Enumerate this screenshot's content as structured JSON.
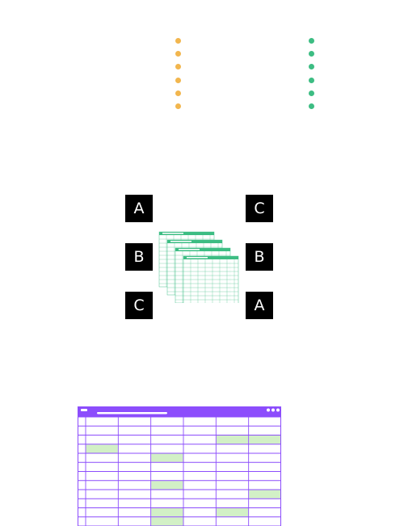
{
  "colors": {
    "yellow_dots": "#f2b64e",
    "green_dots": "#3dbd83",
    "tile_bg": "#000000",
    "tile_text": "#ffffff",
    "sheet_accent": "#3dbd83",
    "window_purple": "#8c4dfc",
    "highlight_green": "#d2f0c6"
  },
  "tiles_left": [
    "A",
    "B",
    "C"
  ],
  "tiles_right": [
    "C",
    "B",
    "A"
  ],
  "sheets": {
    "count": 4,
    "icon": "spreadsheet-stack-icon"
  },
  "grid_window": {
    "icon": "spreadsheet-window-icon",
    "window_buttons": 3,
    "rows": 12,
    "columns": 6,
    "highlighted_cells": [
      [
        2,
        4
      ],
      [
        2,
        5
      ],
      [
        3,
        0
      ],
      [
        4,
        2
      ],
      [
        7,
        2
      ],
      [
        8,
        5
      ],
      [
        10,
        2
      ],
      [
        10,
        4
      ],
      [
        11,
        2
      ]
    ]
  }
}
